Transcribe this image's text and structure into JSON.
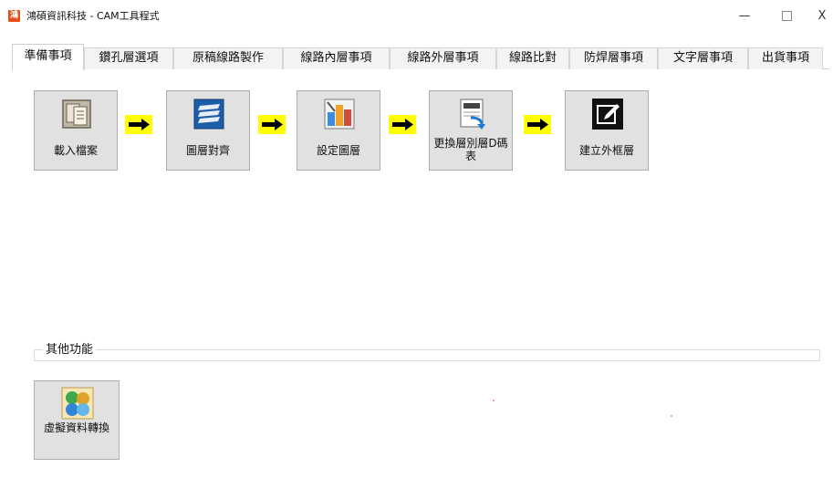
{
  "window": {
    "title": "鴻碩資訊科技 - CAM工具程式",
    "app_icon": "app-logo-icon",
    "controls": {
      "minimize": "—",
      "close": "X"
    }
  },
  "tabs": [
    {
      "label": "準備事項",
      "active": true
    },
    {
      "label": "鑽孔層選項",
      "active": false
    },
    {
      "label": "原稿線路製作",
      "active": false
    },
    {
      "label": "線路內層事項",
      "active": false
    },
    {
      "label": "線路外層事項",
      "active": false
    },
    {
      "label": "線路比對",
      "active": false
    },
    {
      "label": "防焊層事項",
      "active": false
    },
    {
      "label": "文字層事項",
      "active": false
    },
    {
      "label": "出貨事項",
      "active": false
    }
  ],
  "workflow": {
    "steps": [
      {
        "label": "載入檔案",
        "icon": "document-load-icon"
      },
      {
        "label": "圖層對齊",
        "icon": "layers-align-icon"
      },
      {
        "label": "設定圖層",
        "icon": "layer-settings-icon"
      },
      {
        "label": "更換層別層D碼表",
        "icon": "dcode-table-icon"
      },
      {
        "label": "建立外框層",
        "icon": "edit-outline-icon"
      }
    ],
    "arrow_color": "#ffff00"
  },
  "other": {
    "group_title": "其他功能",
    "tools": [
      {
        "label": "虛擬資料轉換",
        "icon": "virtual-data-convert-icon"
      }
    ]
  },
  "colors": {
    "button_face": "#e1e1e1",
    "button_border": "#adadad",
    "arrow_fill": "#ffff00",
    "app_icon": "#e94b1b"
  }
}
